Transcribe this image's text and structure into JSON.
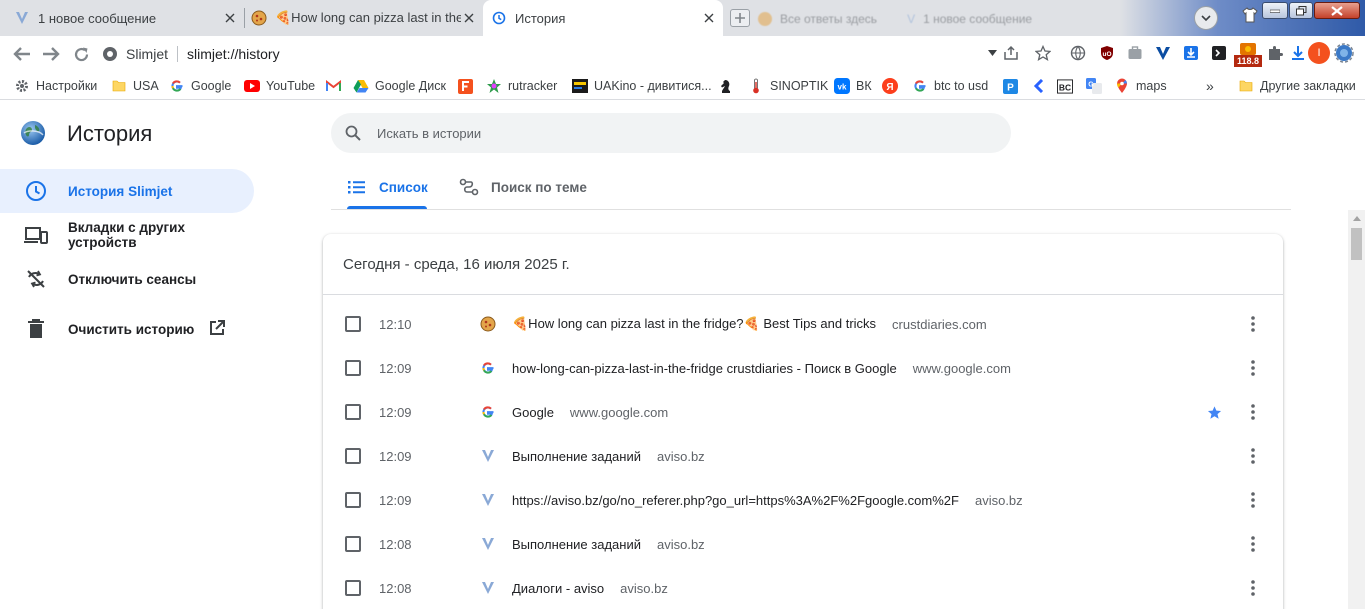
{
  "tabs": [
    {
      "title": "1 новое сообщение",
      "favicon": "aviso-v-icon"
    },
    {
      "title": "🍕How long can pizza last in the fridge",
      "favicon": "pizza-icon"
    },
    {
      "title": "История",
      "favicon": "history-icon",
      "active": true
    }
  ],
  "background_tabs_text": [
    "Все ответы здесь",
    "1 новое сообщение"
  ],
  "address": {
    "site_label": "Slimjet",
    "url": "slimjet://history"
  },
  "extension_badge": "118.8",
  "profile_initial": "I",
  "bookmarks": [
    {
      "label": "Настройки",
      "icon": "gear-icon"
    },
    {
      "label": "USA",
      "icon": "folder-icon"
    },
    {
      "label": "Google",
      "icon": "google-icon"
    },
    {
      "label": "YouTube",
      "icon": "youtube-icon"
    },
    {
      "label": "",
      "icon": "gmail-icon"
    },
    {
      "label": "Google Диск",
      "icon": "google-drive-icon"
    },
    {
      "label": "",
      "icon": "f-square-icon"
    },
    {
      "label": "rutracker",
      "icon": "rutracker-icon"
    },
    {
      "label": "UAKino - дивитися...",
      "icon": "uakino-icon"
    },
    {
      "label": "",
      "icon": "chess-knight-icon"
    },
    {
      "label": "SINOPTIK",
      "icon": "thermometer-icon"
    },
    {
      "label": "ВК",
      "icon": "vk-icon"
    },
    {
      "label": "",
      "icon": "yandex-icon"
    },
    {
      "label": "btc to usd",
      "icon": "google-icon"
    },
    {
      "label": "",
      "icon": "p-square-icon"
    },
    {
      "label": "",
      "icon": "chevron-left-icon"
    },
    {
      "label": "",
      "icon": "bc-icon"
    },
    {
      "label": "",
      "icon": "google-translate-icon"
    },
    {
      "label": "maps",
      "icon": "google-maps-icon"
    }
  ],
  "bookmarks_overflow": "»",
  "other_bookmarks": "Другие закладки",
  "sidebar": {
    "title": "История",
    "items": [
      {
        "label": "История Slimjet",
        "icon": "clock-icon",
        "selected": true
      },
      {
        "label": "Вкладки с других устройств",
        "icon": "devices-icon"
      },
      {
        "label": "Отключить сеансы",
        "icon": "sync-off-icon"
      },
      {
        "label": "Очистить историю",
        "icon": "trash-icon",
        "external": true
      }
    ]
  },
  "search": {
    "placeholder": "Искать в истории"
  },
  "view_tabs": [
    {
      "label": "Список",
      "icon": "list-icon",
      "selected": true
    },
    {
      "label": "Поиск по теме",
      "icon": "journeys-icon"
    }
  ],
  "day_header": "Сегодня - среда, 16 июля 2025 г.",
  "entries": [
    {
      "time": "12:10",
      "title": "🍕How long can pizza last in the fridge?🍕 Best Tips and tricks",
      "domain": "crustdiaries.com",
      "favicon": "pizza-icon",
      "starred": false
    },
    {
      "time": "12:09",
      "title": "how-long-can-pizza-last-in-the-fridge crustdiaries - Поиск в Google",
      "domain": "www.google.com",
      "favicon": "google-icon",
      "starred": false
    },
    {
      "time": "12:09",
      "title": "Google",
      "domain": "www.google.com",
      "favicon": "google-icon",
      "starred": true
    },
    {
      "time": "12:09",
      "title": "Выполнение заданий",
      "domain": "aviso.bz",
      "favicon": "aviso-v-icon",
      "starred": false
    },
    {
      "time": "12:09",
      "title": "https://aviso.bz/go/no_referer.php?go_url=https%3A%2F%2Fgoogle.com%2F",
      "domain": "aviso.bz",
      "favicon": "aviso-v-icon",
      "starred": false
    },
    {
      "time": "12:08",
      "title": "Выполнение заданий",
      "domain": "aviso.bz",
      "favicon": "aviso-v-icon",
      "starred": false
    },
    {
      "time": "12:08",
      "title": "Диалоги - aviso",
      "domain": "aviso.bz",
      "favicon": "aviso-v-icon",
      "starred": false
    }
  ],
  "colors": {
    "accent": "#1a73e8",
    "selected_bg": "#e8f0fe",
    "tabstrip": "#dfe1e5",
    "star": "#4285f4"
  }
}
